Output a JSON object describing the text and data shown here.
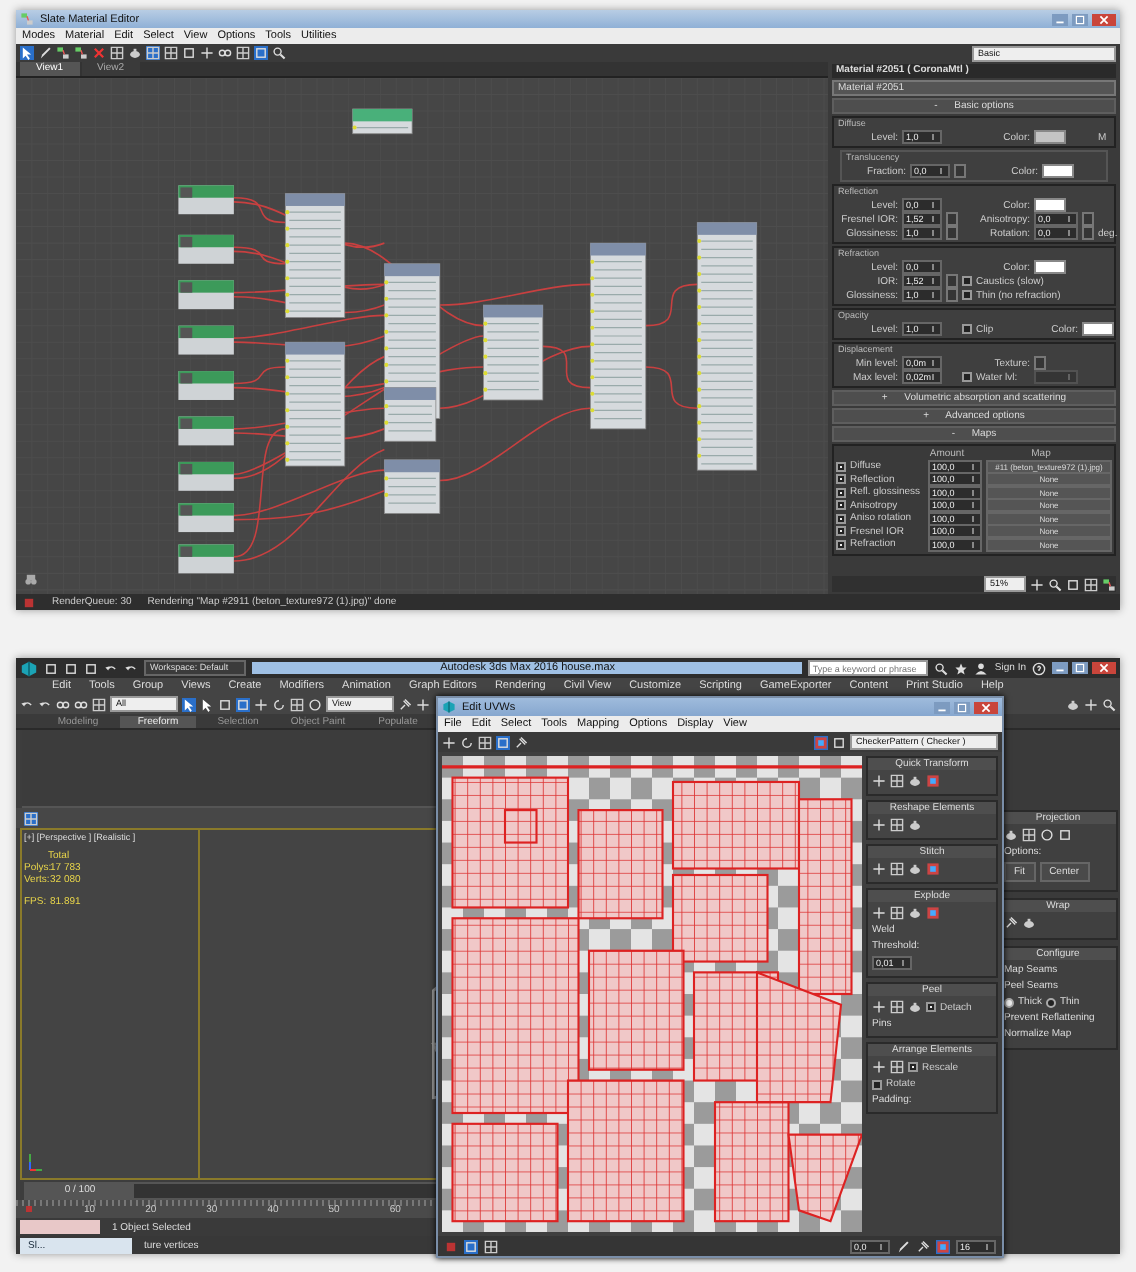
{
  "material_editor": {
    "title": "Slate Material Editor",
    "menu": [
      "Modes",
      "Material",
      "Edit",
      "Select",
      "View",
      "Options",
      "Tools",
      "Utilities"
    ],
    "view_select": "Basic",
    "tabs": [
      {
        "label": "View1",
        "selected": true
      },
      {
        "label": "View2",
        "selected": false
      }
    ],
    "params": {
      "header": "Material #2051  ( CoronaMtl )",
      "name": "Material #2051",
      "rollout": {
        "sign": "-",
        "label": "Basic options"
      },
      "groups": [
        {
          "kind": "group",
          "title": "Diffuse",
          "rows": [
            [
              {
                "kind": "label",
                "text": "Level:"
              },
              {
                "kind": "spinner",
                "text": "1,0"
              },
              {
                "kind": "gap"
              },
              {
                "kind": "label",
                "text": "Color:"
              },
              {
                "kind": "swatch",
                "color": "#c4c4c4"
              },
              {
                "kind": "gap"
              },
              {
                "kind": "label",
                "text": "M"
              }
            ]
          ]
        },
        {
          "kind": "subgroup",
          "title": "Translucency",
          "rows": [
            [
              {
                "kind": "label",
                "text": "Fraction:"
              },
              {
                "kind": "spinner",
                "text": "0,0"
              },
              {
                "kind": "slot"
              },
              {
                "kind": "label",
                "text": "Color:"
              },
              {
                "kind": "swatch",
                "color": "#ffffff"
              }
            ]
          ]
        },
        {
          "kind": "group",
          "title": "Reflection",
          "rows": [
            [
              {
                "kind": "label",
                "text": "Level:"
              },
              {
                "kind": "spinner",
                "text": "0,0"
              },
              {
                "kind": "gap"
              },
              {
                "kind": "label",
                "text": "Color:"
              },
              {
                "kind": "swatch",
                "color": "#ffffff"
              }
            ],
            [
              {
                "kind": "label",
                "text": "Fresnel IOR:"
              },
              {
                "kind": "spinner",
                "text": "1,52"
              },
              {
                "kind": "slot"
              },
              {
                "kind": "label",
                "text": "Anisotropy:"
              },
              {
                "kind": "spinner",
                "text": "0,0"
              },
              {
                "kind": "slot"
              }
            ],
            [
              {
                "kind": "label",
                "text": "Glossiness:"
              },
              {
                "kind": "spinner",
                "text": "1,0"
              },
              {
                "kind": "slot"
              },
              {
                "kind": "label",
                "text": "Rotation:"
              },
              {
                "kind": "spinner",
                "text": "0,0"
              },
              {
                "kind": "slot"
              },
              {
                "kind": "label",
                "text": "deg."
              }
            ]
          ]
        },
        {
          "kind": "group",
          "title": "Refraction",
          "rows": [
            [
              {
                "kind": "label",
                "text": "Level:"
              },
              {
                "kind": "spinner",
                "text": "0,0"
              },
              {
                "kind": "gap"
              },
              {
                "kind": "label",
                "text": "Color:"
              },
              {
                "kind": "swatch",
                "color": "#ffffff"
              }
            ],
            [
              {
                "kind": "label",
                "text": "IOR:"
              },
              {
                "kind": "spinner",
                "text": "1,52"
              },
              {
                "kind": "slot"
              },
              {
                "kind": "check",
                "text": "Caustics (slow)",
                "checked": false
              }
            ],
            [
              {
                "kind": "label",
                "text": "Glossiness:"
              },
              {
                "kind": "spinner",
                "text": "1,0"
              },
              {
                "kind": "slot"
              },
              {
                "kind": "check",
                "text": "Thin (no refraction)",
                "checked": false
              }
            ]
          ]
        },
        {
          "kind": "group",
          "title": "Opacity",
          "rows": [
            [
              {
                "kind": "label",
                "text": "Level:"
              },
              {
                "kind": "spinner",
                "text": "1,0"
              },
              {
                "kind": "gap"
              },
              {
                "kind": "check",
                "text": "Clip",
                "checked": false
              },
              {
                "kind": "label",
                "text": "Color:"
              },
              {
                "kind": "swatch",
                "color": "#ffffff"
              }
            ]
          ]
        },
        {
          "kind": "group",
          "title": "Displacement",
          "rows": [
            [
              {
                "kind": "label",
                "text": "Min level:"
              },
              {
                "kind": "spinner",
                "text": "0,0m"
              },
              {
                "kind": "gap"
              },
              {
                "kind": "label",
                "text": "Texture:"
              },
              {
                "kind": "slot"
              }
            ],
            [
              {
                "kind": "label",
                "text": "Max level:"
              },
              {
                "kind": "spinner",
                "text": "0,02m"
              },
              {
                "kind": "gap"
              },
              {
                "kind": "check",
                "text": "Water lvl:",
                "checked": false
              },
              {
                "kind": "box"
              }
            ]
          ]
        }
      ],
      "rollouts": [
        {
          "sign": "+",
          "label": "Volumetric absorption and scattering"
        },
        {
          "sign": "+",
          "label": "Advanced options"
        },
        {
          "sign": "-",
          "label": "Maps"
        }
      ],
      "maps": {
        "columns": [
          "Amount",
          "Map"
        ],
        "rows": [
          {
            "checked": true,
            "name": "Diffuse",
            "amount": "100,0",
            "map": "#11 (beton_texture972 (1).jpg)"
          },
          {
            "checked": true,
            "name": "Reflection",
            "amount": "100,0",
            "map": "None"
          },
          {
            "checked": true,
            "name": "Refl. glossiness",
            "amount": "100,0",
            "map": "None"
          },
          {
            "checked": true,
            "name": "Anisotropy",
            "amount": "100,0",
            "map": "None"
          },
          {
            "checked": true,
            "name": "Aniso rotation",
            "amount": "100,0",
            "map": "None"
          },
          {
            "checked": true,
            "name": "Fresnel IOR",
            "amount": "100,0",
            "map": "None"
          },
          {
            "checked": true,
            "name": "Refraction",
            "amount": "100,0",
            "map": "None"
          }
        ]
      },
      "zoom": "51%"
    },
    "status": [
      "RenderQueue: 30",
      "Rendering \"Map #2911 (beton_texture972 (1).jpg)\" done"
    ]
  },
  "max_window": {
    "workspace": "Workspace: Default",
    "title": "Autodesk 3ds Max 2016    house.max",
    "search": {
      "placeholder": "Type a keyword or phrase"
    },
    "sign_in": "Sign In",
    "menu": [
      "Edit",
      "Tools",
      "Group",
      "Views",
      "Create",
      "Modifiers",
      "Animation",
      "Graph Editors",
      "Rendering",
      "Civil View",
      "Customize",
      "Scripting",
      "GameExporter",
      "Content",
      "Print Studio",
      "Help"
    ],
    "selection_filter": "All",
    "reference": "View",
    "ribbon_tabs": [
      {
        "label": "Modeling",
        "selected": false
      },
      {
        "label": "Freeform",
        "selected": true
      },
      {
        "label": "Selection",
        "selected": false
      },
      {
        "label": "Object Paint",
        "selected": false
      },
      {
        "label": "Populate",
        "selected": false
      }
    ],
    "viewport": {
      "label": "[+] [Perspective ] [Realistic ]",
      "stats_header": "Total",
      "stats": [
        {
          "label": "Polys:",
          "value": "17 783"
        },
        {
          "label": "Verts:",
          "value": "32 080"
        },
        {
          "label": "FPS:",
          "value": "81.891"
        }
      ]
    },
    "timeline": {
      "frame": "0 / 100",
      "level": 0,
      "ticks": [
        "10",
        "20",
        "30",
        "40",
        "50",
        "60"
      ]
    },
    "status": "1 Object Selected",
    "prompt": "ture vertices",
    "taskbar_preview": "Sl...",
    "command_panel": [
      {
        "title": "Projection",
        "items": [
          {
            "kind": "label",
            "text": "Options:"
          },
          {
            "kind": "button",
            "text": "Fit"
          },
          {
            "kind": "button",
            "text": "Center"
          }
        ]
      },
      {
        "title": "Wrap"
      },
      {
        "title": "Configure",
        "items": [
          {
            "kind": "label",
            "text": "Map Seams"
          },
          {
            "kind": "label",
            "text": "Peel Seams"
          },
          {
            "kind": "radio",
            "text": "Thick",
            "selected": true
          },
          {
            "kind": "radio",
            "text": "Thin",
            "selected": false
          },
          {
            "kind": "label",
            "text": "Prevent Reflattening"
          },
          {
            "kind": "label",
            "text": "Normalize Map"
          }
        ]
      }
    ]
  },
  "uvw_editor": {
    "title": "Edit UVWs",
    "menu": [
      "File",
      "Edit",
      "Select",
      "Tools",
      "Mapping",
      "Options",
      "Display",
      "View"
    ],
    "texture_select": "CheckerPattern ( Checker )",
    "sections": [
      {
        "title": "Quick Transform"
      },
      {
        "title": "Reshape Elements"
      },
      {
        "title": "Stitch"
      },
      {
        "title": "Explode",
        "items": [
          {
            "kind": "label",
            "text": "Weld"
          },
          {
            "kind": "label",
            "text": "Threshold:"
          },
          {
            "kind": "spinner",
            "text": "0,01"
          }
        ]
      },
      {
        "title": "Peel",
        "items": [
          {
            "kind": "check",
            "text": "Detach",
            "checked": true
          },
          {
            "kind": "label",
            "text": "Pins"
          }
        ]
      },
      {
        "title": "Arrange Elements",
        "items": [
          {
            "kind": "check",
            "text": "Rescale",
            "checked": true
          },
          {
            "kind": "check",
            "text": "Rotate",
            "checked": false
          },
          {
            "kind": "label",
            "text": "Padding:"
          }
        ]
      }
    ],
    "spinners": [
      "0,0",
      "16"
    ]
  }
}
